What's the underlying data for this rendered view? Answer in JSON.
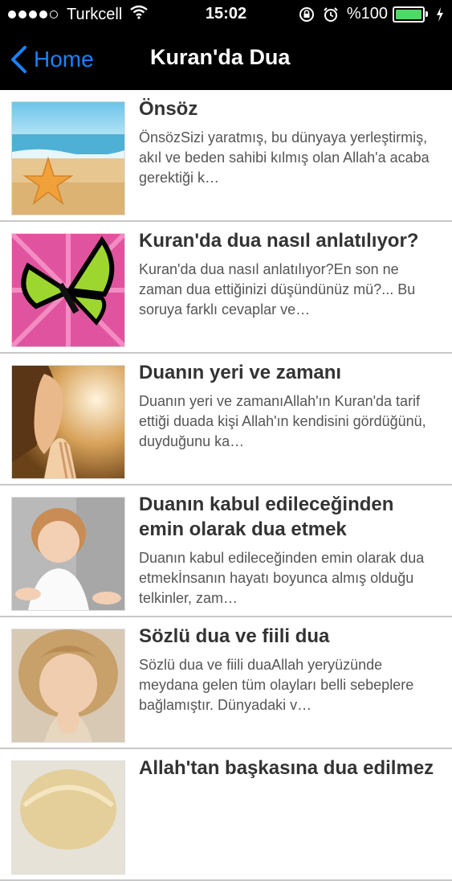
{
  "status_bar": {
    "carrier": "Turkcell",
    "time": "15:02",
    "battery": "%100",
    "battery_level": 1.0,
    "signal_bars": 4,
    "signal_total": 5,
    "icons": [
      "wifi-icon",
      "rotation-lock-icon",
      "alarm-icon",
      "battery-icon",
      "charging-bolt-icon"
    ]
  },
  "nav": {
    "back_label": "Home",
    "title": "Kuran'da Dua"
  },
  "articles": [
    {
      "title": "Önsöz",
      "summary": "ÖnsözSizi yaratmış, bu dünyaya yerleştirmiş, akıl ve beden sahibi kılmış olan Allah'a acaba gerektiği k…",
      "image": "beach-starfish"
    },
    {
      "title": "Kuran'da dua nasıl anlatılıyor?",
      "summary": "Kuran'da dua nasıl anlatılıyor?En son ne zaman dua ettiğinizi düşündünüz mü?...  Bu soruya farklı cevaplar ve…",
      "image": "butterfly-flower"
    },
    {
      "title": "Duanın yeri ve zamanı",
      "summary": "Duanın yeri ve zamanıAllah'ın Kuran'da tarif ettiği duada kişi Allah'ın kendisini gördüğünü, duyduğunu ka…",
      "image": "praying-woman"
    },
    {
      "title": "Duanın kabul edileceğinden emin olarak dua etmek",
      "summary": "Duanın kabul edileceğinden emin olarak dua etmekİnsanın hayatı boyunca almış olduğu telkinler, zam…",
      "image": "praying-child"
    },
    {
      "title": "Sözlü dua ve fiili dua",
      "summary": "Sözlü dua ve fiili duaAllah yeryüzünde meydana gelen tüm olayları belli sebeplere bağlamıştır. Dünyadaki v…",
      "image": "praying-girl"
    },
    {
      "title": "Allah'tan başkasına dua edilmez",
      "summary": "",
      "image": "praying-blonde"
    }
  ]
}
